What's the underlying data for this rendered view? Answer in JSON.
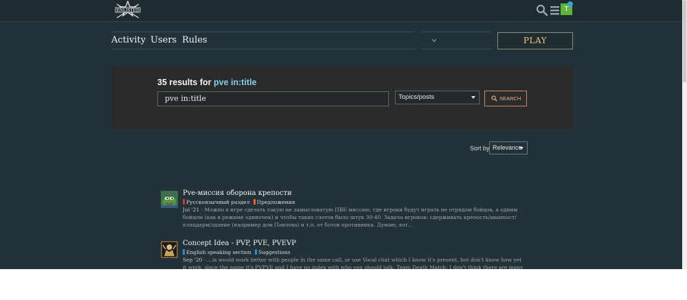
{
  "header": {
    "logo_text": "ENLISTED",
    "icons": [
      "search-icon",
      "hamburger-menu-icon"
    ],
    "user_avatar_letter": "T"
  },
  "nav": {
    "items": [
      {
        "label": "Activity"
      },
      {
        "label": "Users"
      },
      {
        "label": "Rules"
      }
    ],
    "play_label": "PLAY"
  },
  "search": {
    "results_count_prefix": "35 results for",
    "query": "pve in:title",
    "input_value": "pve in:title",
    "scope_value": "Topics/posts",
    "button_label": "SEARCH"
  },
  "sort": {
    "label": "Sort by",
    "value": "Relevance"
  },
  "results": [
    {
      "title": "Pve-миссия оборона крепости",
      "tags": [
        {
          "label": "Русскоязычный раздел",
          "color": "#c8402c"
        },
        {
          "label": "Предложения",
          "color": "#e06a2c"
        }
      ],
      "date": "Jul '21",
      "blurb": "- Можно в игре сделать такую не замысловатую ПВЕ миссию, где игроки будут играть не отрядом бойцов, а одним бойцом (как в режиме одиночек) и чтобы таких слотов было штук 30-40. Задача игроков: сдерживать крепость/аванпост/плацдарм/здание (например дом Павлова) и т.п. от ботов противника. Думаю, хот…"
    },
    {
      "title": "Concept Idea - PVP, PVE, PVEVP",
      "tags": [
        {
          "label": "English speaking section",
          "color": "#2a8fc9"
        },
        {
          "label": "Suggestions",
          "color": "#2a8fc9"
        }
      ],
      "date": "Sep '20",
      "blurb": "- …is would work better with people in the same call, or use Vocal chat which I know it's present. but don't know how yet it work. since the game it's PVPVE and I have no index with who you should talk. Team Death Match: I don't think there are many explanations to give"
    }
  ],
  "colors": {
    "background": "#233238",
    "header": "#1e2c31",
    "panel": "#2a2b2b",
    "accent_play": "#f0c873",
    "accent_search": "#d28a5c",
    "query_highlight": "#7fd0ea"
  }
}
